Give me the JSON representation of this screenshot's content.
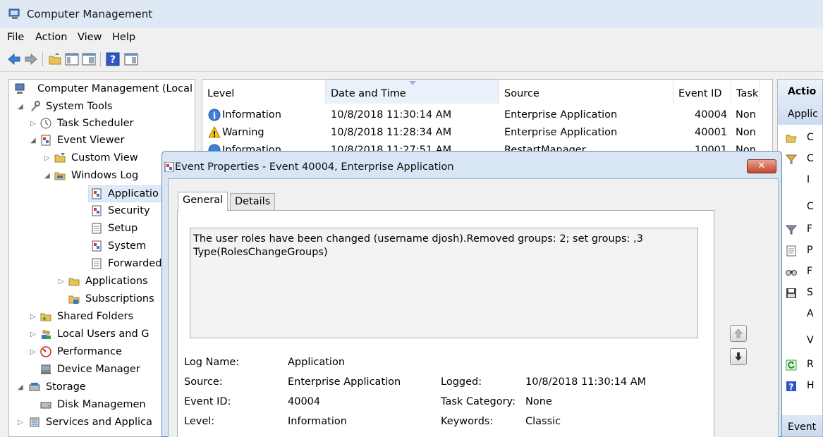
{
  "window": {
    "title": "Computer Management"
  },
  "menu": [
    "File",
    "Action",
    "View",
    "Help"
  ],
  "toolbar": {
    "icons": [
      "back-arrow-icon",
      "forward-arrow-icon",
      "up-folder-icon",
      "show-hide-tree-icon",
      "help-icon",
      "show-hide-action-pane-icon"
    ]
  },
  "tree": {
    "root": "Computer Management (Local",
    "system_tools": "System Tools",
    "task_scheduler": "Task Scheduler",
    "event_viewer": "Event Viewer",
    "custom_views": "Custom View",
    "windows_logs": "Windows Log",
    "application": "Applicatio",
    "security": "Security",
    "setup": "Setup",
    "system": "System",
    "forwarded": "Forwarded",
    "apps_services": "Applications",
    "subscriptions": "Subscriptions",
    "shared_folders": "Shared Folders",
    "local_users": "Local Users and G",
    "performance": "Performance",
    "device_manager": "Device Manager",
    "storage": "Storage",
    "disk_management": "Disk Managemen",
    "services_apps": "Services and Applica"
  },
  "eventlist": {
    "columns": [
      "Level",
      "Date and Time",
      "Source",
      "Event ID",
      "Task"
    ],
    "rows": [
      {
        "level": "Information",
        "datetime": "10/8/2018 11:30:14 AM",
        "source": "Enterprise Application",
        "event_id": "40004",
        "task": "Non"
      },
      {
        "level": "Warning",
        "datetime": "10/8/2018 11:28:34 AM",
        "source": "Enterprise Application",
        "event_id": "40001",
        "task": "Non"
      },
      {
        "level": "Information",
        "datetime": "10/8/2018 11:27:51 AM",
        "source": "RestartManager",
        "event_id": "10001",
        "task": "Non"
      }
    ]
  },
  "actions": {
    "header": "Actio",
    "subheader": "Applic",
    "items": [
      {
        "icon": "open-folder-icon",
        "label": "C"
      },
      {
        "icon": "filter-icon",
        "label": "C"
      },
      {
        "icon": "",
        "label": "I"
      },
      {
        "icon": "",
        "label": "C"
      },
      {
        "icon": "filter-icon",
        "label": "F"
      },
      {
        "icon": "properties-icon",
        "label": "P"
      },
      {
        "icon": "find-icon",
        "label": "F"
      },
      {
        "icon": "save-icon",
        "label": "S"
      },
      {
        "icon": "",
        "label": "A"
      },
      {
        "icon": "",
        "label": "V"
      },
      {
        "icon": "refresh-icon",
        "label": "R"
      },
      {
        "icon": "help-icon",
        "label": "H"
      }
    ],
    "footer": "Event"
  },
  "dialog": {
    "title": "Event Properties - Event 40004, Enterprise Application",
    "tabs": [
      "General",
      "Details"
    ],
    "message": "The user roles have been changed (username djosh).Removed groups: 2; set groups: ,3 Type(RolesChangeGroups)",
    "fields": {
      "log_name_label": "Log Name:",
      "log_name": "Application",
      "source_label": "Source:",
      "source": "Enterprise Application",
      "logged_label": "Logged:",
      "logged": "10/8/2018 11:30:14 AM",
      "event_id_label": "Event ID:",
      "event_id": "40004",
      "task_category_label": "Task Category:",
      "task_category": "None",
      "level_label": "Level:",
      "level": "Information",
      "keywords_label": "Keywords:",
      "keywords": "Classic"
    },
    "close_glyph": "✕"
  },
  "colors": {
    "titlebar": "#dfe9f5",
    "selection": "#ddeaf8",
    "dialog_frame": "#d7e5f4",
    "close_button": "#c4452b"
  }
}
